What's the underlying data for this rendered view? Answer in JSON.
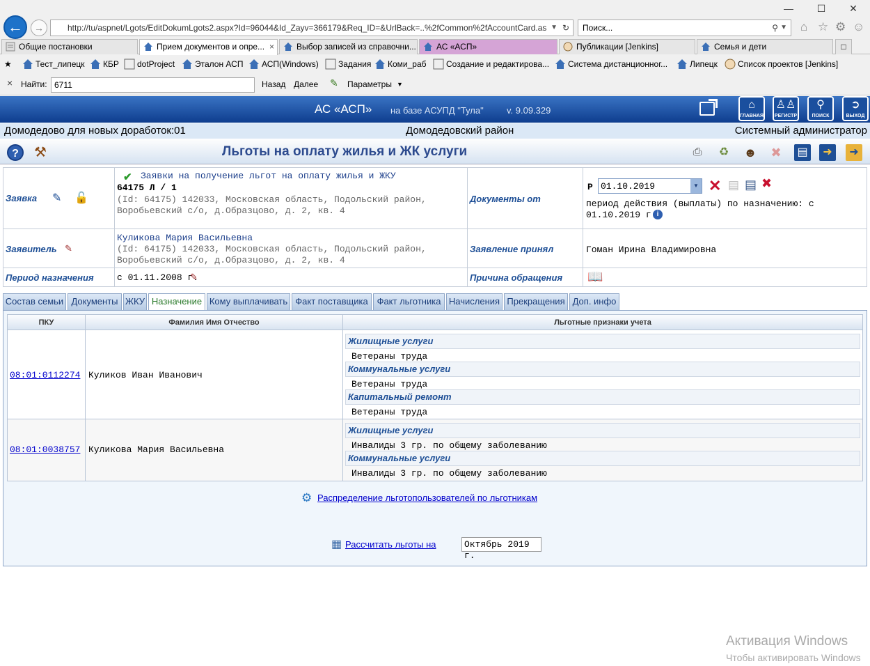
{
  "browser": {
    "url": "http://tu/aspnet/Lgots/EditDokumLgots2.aspx?Id=96044&Id_Zayv=366179&Req_ID=&UrlBack=..%2fCommon%2fAccountCard.as",
    "search_placeholder": "Поиск...",
    "tabs": [
      {
        "label": "Общие постановки"
      },
      {
        "label": "Прием документов и опре..."
      },
      {
        "label": "Выбор записей из справочни..."
      },
      {
        "label": "АС «АСП»"
      },
      {
        "label": "Публикации [Jenkins]"
      },
      {
        "label": "Семья и дети"
      }
    ],
    "favorites": [
      {
        "label": "Тест_липецк"
      },
      {
        "label": "КБР"
      },
      {
        "label": "dotProject"
      },
      {
        "label": "Эталон АСП"
      },
      {
        "label": "АСП(Windows)"
      },
      {
        "label": "Задания"
      },
      {
        "label": "Коми_раб"
      },
      {
        "label": "Создание и редактирова..."
      },
      {
        "label": "Система дистанционног..."
      },
      {
        "label": "Липецк"
      },
      {
        "label": "Список проектов [Jenkins]"
      }
    ],
    "find": {
      "label": "Найти:",
      "value": "6711",
      "back": "Назад",
      "next": "Далее",
      "params": "Параметры"
    }
  },
  "app": {
    "title": "АС «АСП»",
    "subtitle": "на базе АСУПД \"Тула\"",
    "version": "v. 9.09.329",
    "nav": [
      {
        "label": "ГЛАВНАЯ",
        "icon": "home-icon"
      },
      {
        "label": "РЕГИСТР",
        "icon": "people-icon"
      },
      {
        "label": "ПОИСК",
        "icon": "search-icon"
      },
      {
        "label": "ВЫХОД",
        "icon": "exit-icon"
      }
    ]
  },
  "info": {
    "org": "Домодедово для новых доработок:01",
    "district": "Домодедовский район",
    "user": "Системный администратор"
  },
  "page_title": "Льготы на оплату жилья и ЖК услуги",
  "form": {
    "request_label": "Заявка",
    "request_title": "Заявки на получение льгот на оплату жилья и ЖКУ",
    "request_number": "64175 Л / 1",
    "request_addr_1": "(Id: 64175) 142033, Московская область, Подольский район,",
    "request_addr_2": "Воробьевский с/о, д.Образцово, д. 2, кв. 4",
    "docs_from_label": "Документы от",
    "docs_from_prefix": "Р",
    "docs_from_date": "01.10.2019",
    "period_note_1": "период действия (выплаты) по назначению: с",
    "period_note_2": "01.10.2019 г.",
    "applicant_label": "Заявитель",
    "applicant_name": "Куликова Мария Васильевна",
    "applicant_addr_1": "(Id: 64175) 142033, Московская область, Подольский район,",
    "applicant_addr_2": "Воробьевский с/о, д.Образцово, д. 2, кв. 4",
    "accepted_label": "Заявление принял",
    "accepted_by": "Гоман Ирина Владимировна",
    "period_label": "Период назначения",
    "period_value": "с 01.11.2008 г.",
    "reason_label": "Причина обращения"
  },
  "tabs": [
    {
      "label": "Состав семьи"
    },
    {
      "label": "Документы"
    },
    {
      "label": "ЖКУ"
    },
    {
      "label": "Назначение"
    },
    {
      "label": "Кому выплачивать"
    },
    {
      "label": "Факт поставщика"
    },
    {
      "label": "Факт льготника"
    },
    {
      "label": "Начисления"
    },
    {
      "label": "Прекращения"
    },
    {
      "label": "Доп. инфо"
    }
  ],
  "grid": {
    "headers": [
      "ПКУ",
      "Фамилия Имя Отчество",
      "Льготные признаки учета"
    ],
    "rows": [
      {
        "pku": "08:01:0112274",
        "fio": "Куликов Иван Иванович",
        "cats": [
          {
            "name": "Жилищные услуги",
            "value": "Ветераны труда"
          },
          {
            "name": "Коммунальные услуги",
            "value": "Ветераны труда"
          },
          {
            "name": "Капитальный ремонт",
            "value": "Ветераны труда"
          }
        ]
      },
      {
        "pku": "08:01:0038757",
        "fio": "Куликова Мария Васильевна",
        "cats": [
          {
            "name": "Жилищные услуги",
            "value": "Инвалиды 3 гр. по общему заболеванию"
          },
          {
            "name": "Коммунальные услуги",
            "value": "Инвалиды 3 гр. по общему заболеванию"
          }
        ]
      }
    ]
  },
  "distribution_link": "Распределение льготопользователей по льготникам",
  "calc_link": "Рассчитать льготы на",
  "calc_month": "Октябрь 2019 г.",
  "watermark": {
    "line1": "Активация Windows",
    "line2": "Чтобы активировать Windows"
  }
}
